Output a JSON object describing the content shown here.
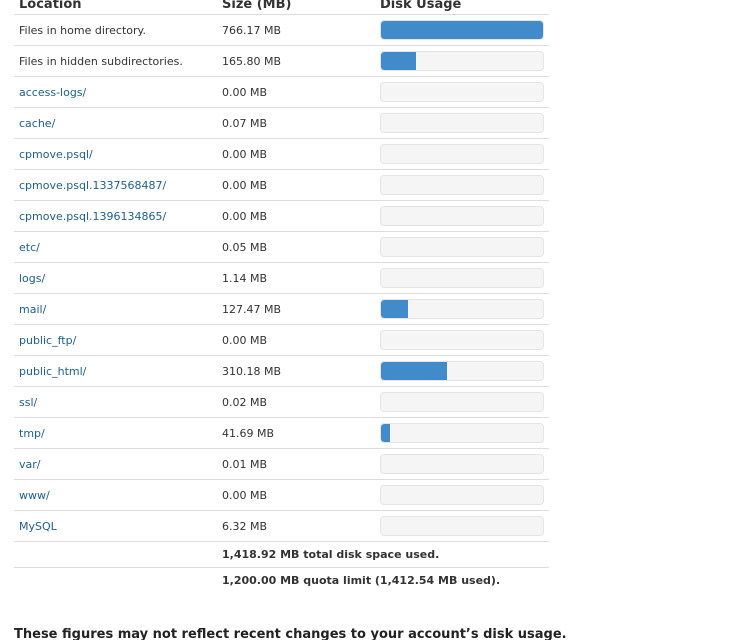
{
  "table": {
    "headers": {
      "location": "Location",
      "size": "Size (MB)",
      "usage": "Disk Usage"
    },
    "rows": [
      {
        "location": "Files in home directory.",
        "size": "766.17 MB",
        "usage_fraction": 1.0,
        "link": false
      },
      {
        "location": "Files in hidden subdirectories.",
        "size": "165.80 MB",
        "usage_fraction": 0.2164,
        "link": false
      },
      {
        "location": "access-logs/",
        "size": "0.00 MB",
        "usage_fraction": 0.0,
        "link": true
      },
      {
        "location": "cache/",
        "size": "0.07 MB",
        "usage_fraction": 0.0,
        "link": true
      },
      {
        "location": "cpmove.psql/",
        "size": "0.00 MB",
        "usage_fraction": 0.0,
        "link": true
      },
      {
        "location": "cpmove.psql.1337568487/",
        "size": "0.00 MB",
        "usage_fraction": 0.0,
        "link": true
      },
      {
        "location": "cpmove.psql.1396134865/",
        "size": "0.00 MB",
        "usage_fraction": 0.0,
        "link": true
      },
      {
        "location": "etc/",
        "size": "0.05 MB",
        "usage_fraction": 0.0,
        "link": true
      },
      {
        "location": "logs/",
        "size": "1.14 MB",
        "usage_fraction": 0.0,
        "link": true
      },
      {
        "location": "mail/",
        "size": "127.47 MB",
        "usage_fraction": 0.1664,
        "link": true
      },
      {
        "location": "public_ftp/",
        "size": "0.00 MB",
        "usage_fraction": 0.0,
        "link": true
      },
      {
        "location": "public_html/",
        "size": "310.18 MB",
        "usage_fraction": 0.4048,
        "link": true
      },
      {
        "location": "ssl/",
        "size": "0.02 MB",
        "usage_fraction": 0.0,
        "link": true
      },
      {
        "location": "tmp/",
        "size": "41.69 MB",
        "usage_fraction": 0.0544,
        "link": true
      },
      {
        "location": "var/",
        "size": "0.01 MB",
        "usage_fraction": 0.0,
        "link": true
      },
      {
        "location": "www/",
        "size": "0.00 MB",
        "usage_fraction": 0.0,
        "link": true
      },
      {
        "location": "MySQL",
        "size": "6.32 MB",
        "usage_fraction": 0.0,
        "link": true
      }
    ],
    "total_text": "1,418.92 MB total disk space used.",
    "quota_text": "1,200.00 MB quota limit (1,412.54 MB used)."
  },
  "note": "These figures may not reflect recent changes to your account’s disk usage.",
  "colors": {
    "bar_fill": "#428bca",
    "link": "#1f5f8b"
  }
}
